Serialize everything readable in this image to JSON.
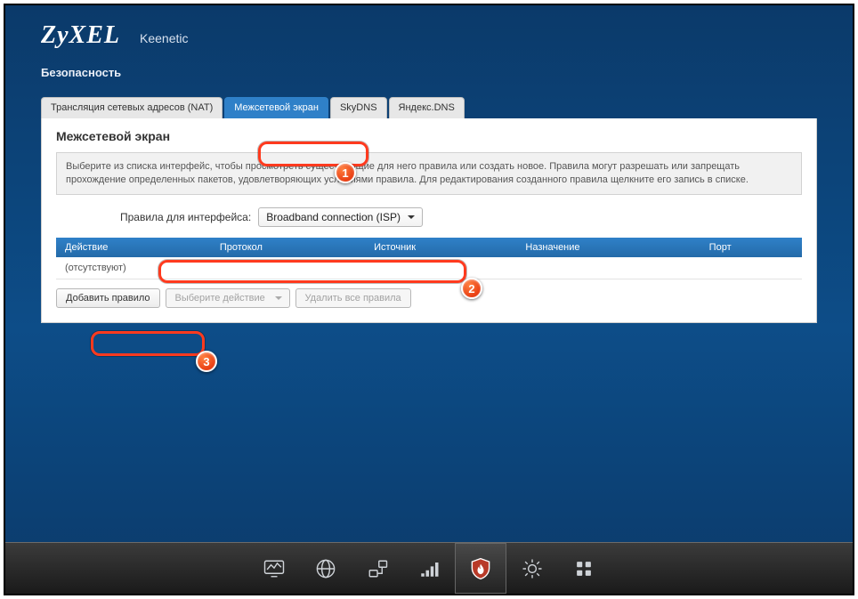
{
  "header": {
    "brand": "ZyXEL",
    "model": "Keenetic",
    "section": "Безопасность"
  },
  "tabs": [
    {
      "label": "Трансляция сетевых адресов (NAT)",
      "active": false
    },
    {
      "label": "Межсетевой экран",
      "active": true
    },
    {
      "label": "SkyDNS",
      "active": false
    },
    {
      "label": "Яндекс.DNS",
      "active": false
    }
  ],
  "panel": {
    "heading": "Межсетевой экран",
    "info": "Выберите из списка интерфейс, чтобы просмотреть существующие для него правила или создать новое. Правила могут разрешать или запрещать прохождение определенных пакетов, удовлетворяющих условиями правила. Для редактирования созданного правила щелкните его запись в списке.",
    "iface_label": "Правила для интерфейса:",
    "iface_value": "Broadband connection (ISP)",
    "columns": {
      "action": "Действие",
      "protocol": "Протокол",
      "source": "Источник",
      "dest": "Назначение",
      "port": "Порт"
    },
    "empty_text": "(отсутствуют)",
    "buttons": {
      "add": "Добавить правило",
      "select_action": "Выберите действие",
      "delete_all": "Удалить все правила"
    }
  },
  "annotations": {
    "b1": "1",
    "b2": "2",
    "b3": "3"
  },
  "dock": [
    {
      "name": "monitor",
      "active": false
    },
    {
      "name": "globe",
      "active": false
    },
    {
      "name": "network",
      "active": false
    },
    {
      "name": "wifi",
      "active": false
    },
    {
      "name": "security",
      "active": true
    },
    {
      "name": "settings",
      "active": false
    },
    {
      "name": "apps",
      "active": false
    }
  ]
}
